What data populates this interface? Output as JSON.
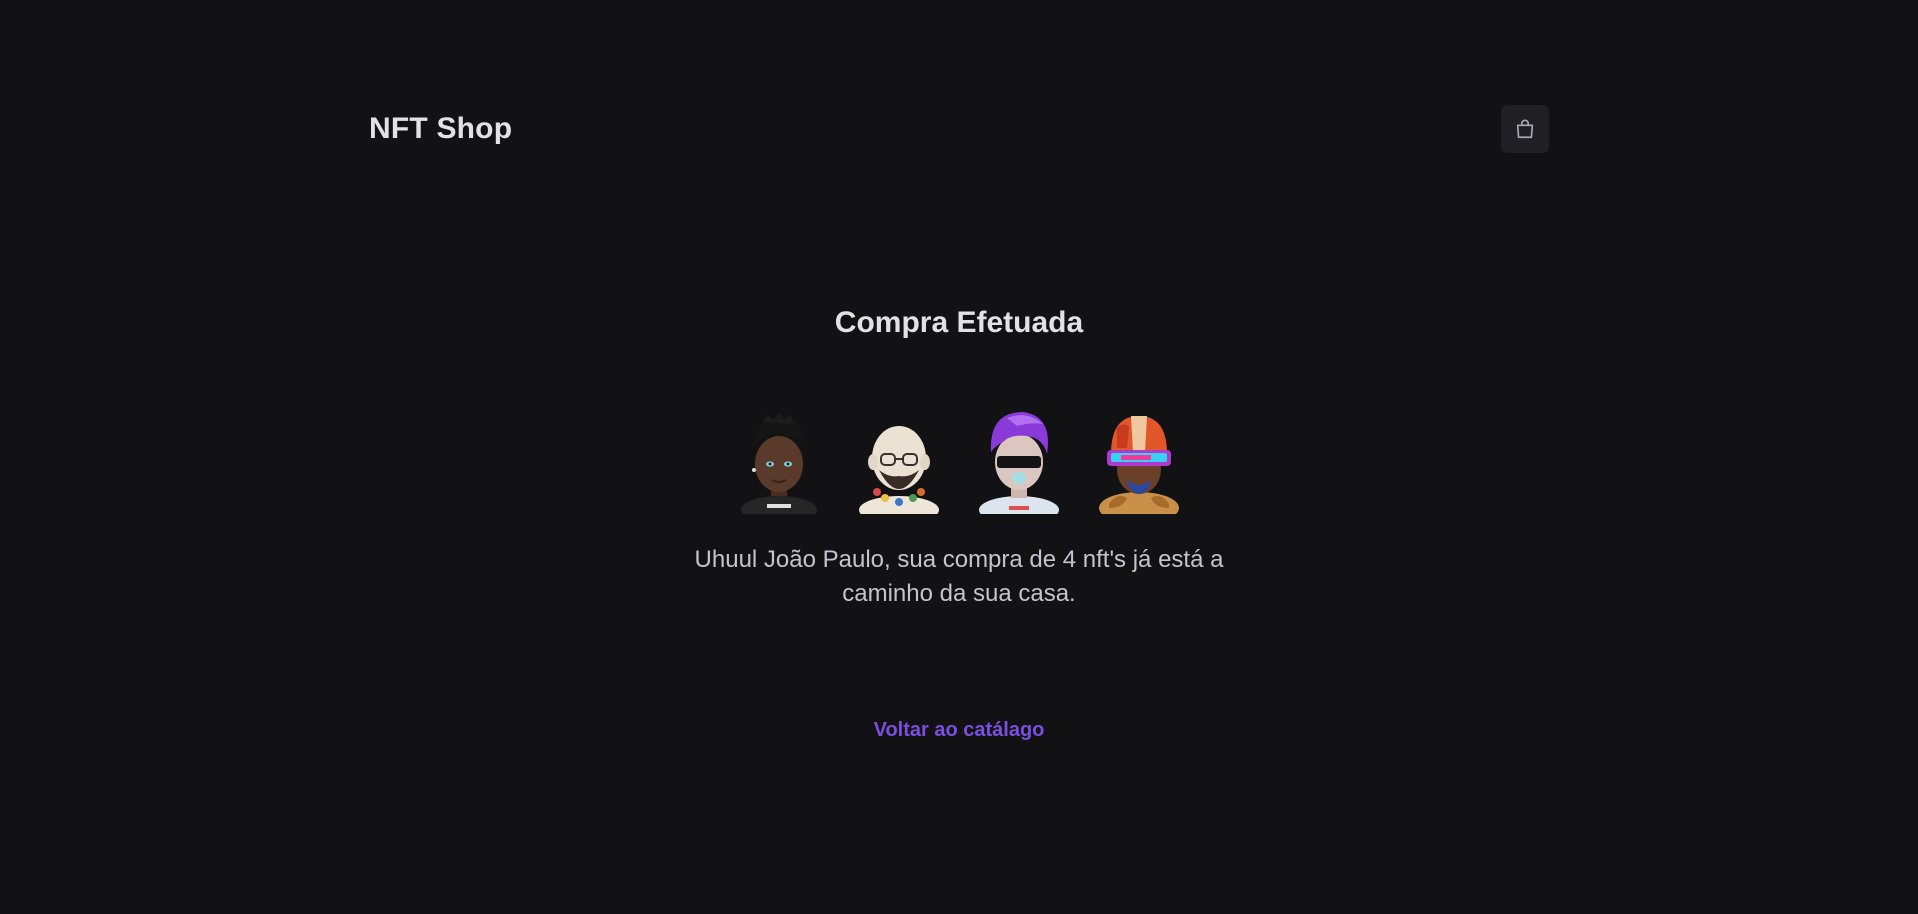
{
  "header": {
    "logo": "NFT Shop",
    "cart_icon": "shopping-bag-icon"
  },
  "main": {
    "title": "Compra Efetuada",
    "avatars": [
      {
        "name": "nft-avatar-1",
        "hair": "#1a1a1a",
        "skin": "#5a3a2a",
        "shirt": "#2a2a2a"
      },
      {
        "name": "nft-avatar-2",
        "hair": "#e8dccd",
        "skin": "#e8dccd",
        "shirt": "#2d2d2d"
      },
      {
        "name": "nft-avatar-3",
        "hair": "#8a3ad8",
        "skin": "#d9c4be",
        "shirt": "#e8eef5"
      },
      {
        "name": "nft-avatar-4",
        "hair": "#e0582a",
        "skin": "#7a4a30",
        "shirt": "#c89048"
      }
    ],
    "message": "Uhuul João Paulo, sua compra de 4 nft's já está a caminho da sua casa.",
    "back_link": "Voltar ao catálago"
  },
  "colors": {
    "background": "#121214",
    "accent": "#7a4fe0",
    "text": "#e1e1e6"
  }
}
